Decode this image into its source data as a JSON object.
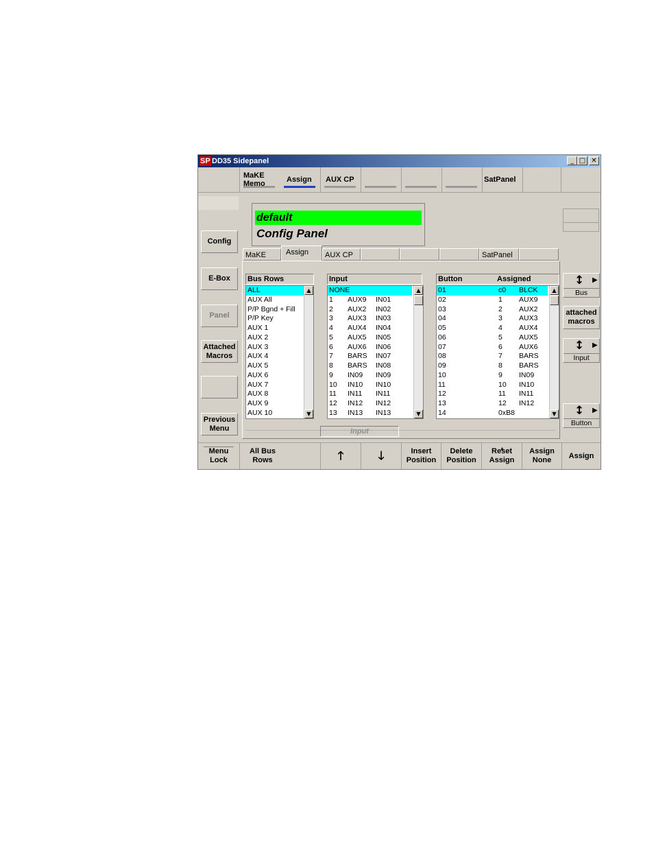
{
  "window": {
    "logo": "SP",
    "title": "DD35 Sidepanel",
    "min": "_",
    "max": "□",
    "close": "✕"
  },
  "top_tabs": [
    {
      "label": "MaKE Memo"
    },
    {
      "label": "Assign"
    },
    {
      "label": "AUX CP"
    },
    {
      "label": ""
    },
    {
      "label": ""
    },
    {
      "label": ""
    },
    {
      "label": "SatPanel"
    },
    {
      "label": ""
    }
  ],
  "display": {
    "line1": "default",
    "line2": "Config Panel"
  },
  "left_buttons": {
    "config": "Config",
    "ebox": "E-Box",
    "panel": "Panel",
    "attached": "Attached Macros",
    "blank": "",
    "previous": "Previous Menu"
  },
  "sub_tabs": [
    {
      "label": "MaKE"
    },
    {
      "label": "Assign"
    },
    {
      "label": "AUX CP"
    },
    {
      "label": ""
    },
    {
      "label": ""
    },
    {
      "label": ""
    },
    {
      "label": "SatPanel"
    },
    {
      "label": ""
    }
  ],
  "bus_rows": {
    "header": "Bus Rows",
    "items": [
      "ALL",
      "AUX All",
      "P/P Bgnd + Fill",
      "P/P Key",
      "AUX 1",
      "AUX 2",
      "AUX 3",
      "AUX 4",
      "AUX 5",
      "AUX 6",
      "AUX 7",
      "AUX 8",
      "AUX 9",
      "AUX 10"
    ]
  },
  "inputs": {
    "header": "Input",
    "items": [
      [
        "NONE",
        "",
        ""
      ],
      [
        "1",
        "AUX9",
        "IN01"
      ],
      [
        "2",
        "AUX2",
        "IN02"
      ],
      [
        "3",
        "AUX3",
        "IN03"
      ],
      [
        "4",
        "AUX4",
        "IN04"
      ],
      [
        "5",
        "AUX5",
        "IN05"
      ],
      [
        "6",
        "AUX6",
        "IN06"
      ],
      [
        "7",
        "BARS",
        "IN07"
      ],
      [
        "8",
        "BARS",
        "IN08"
      ],
      [
        "9",
        "IN09",
        "IN09"
      ],
      [
        "10",
        "IN10",
        "IN10"
      ],
      [
        "11",
        "IN11",
        "IN11"
      ],
      [
        "12",
        "IN12",
        "IN12"
      ],
      [
        "13",
        "IN13",
        "IN13"
      ]
    ]
  },
  "buttons_list": {
    "header_button": "Button",
    "header_assigned": "Assigned",
    "items": [
      [
        "01",
        "c0",
        "BLCK"
      ],
      [
        "02",
        "1",
        "AUX9"
      ],
      [
        "03",
        "2",
        "AUX2"
      ],
      [
        "04",
        "3",
        "AUX3"
      ],
      [
        "05",
        "4",
        "AUX4"
      ],
      [
        "06",
        "5",
        "AUX5"
      ],
      [
        "07",
        "6",
        "AUX6"
      ],
      [
        "08",
        "7",
        "BARS"
      ],
      [
        "09",
        "8",
        "BARS"
      ],
      [
        "10",
        "9",
        "IN09"
      ],
      [
        "11",
        "10",
        "IN10"
      ],
      [
        "12",
        "11",
        "IN11"
      ],
      [
        "13",
        "12",
        "IN12"
      ],
      [
        "14",
        "0xB8",
        ""
      ]
    ]
  },
  "input_label": "Input",
  "right_panel": {
    "bus": "Bus",
    "attached": "attached macros",
    "input": "Input",
    "button": "Button"
  },
  "bottom": {
    "menu_lock": "Menu Lock",
    "all_bus_rows": "All Bus Rows",
    "up": "🡑",
    "down": "🡓",
    "insert": "Insert Position",
    "delete": "Delete Position",
    "reset": "Reset Assign",
    "assign_none": "Assign None",
    "assign": "Assign"
  }
}
